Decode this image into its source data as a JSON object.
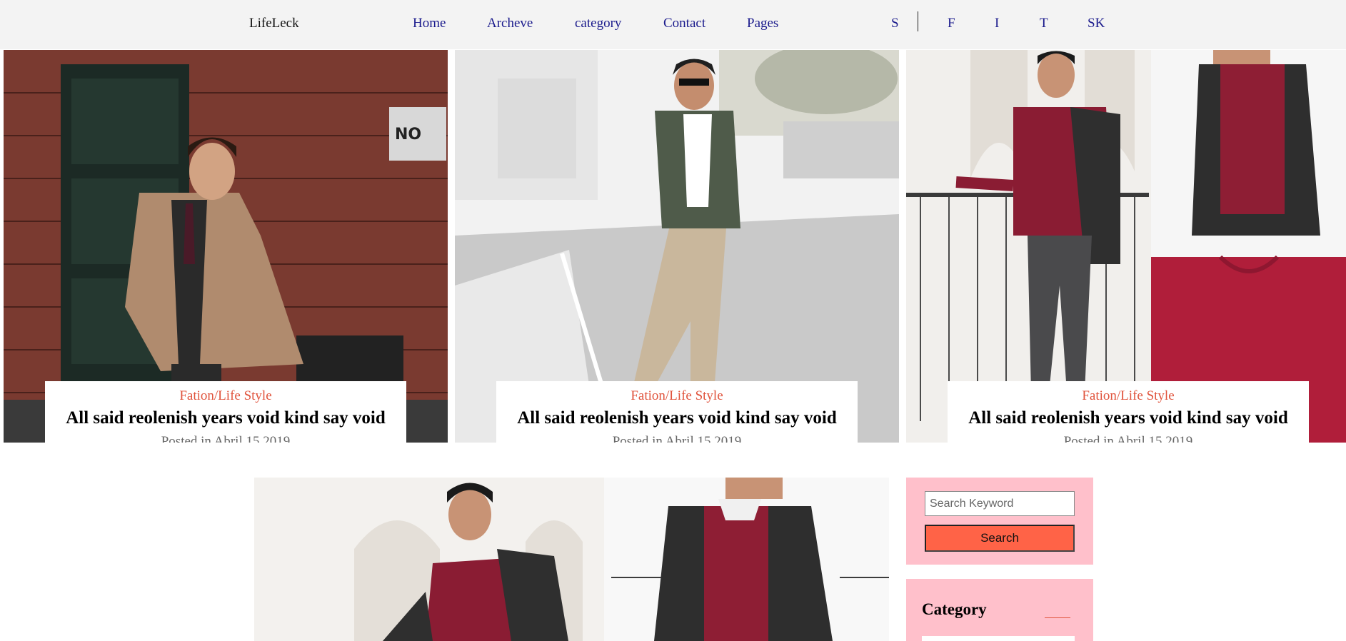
{
  "nav": {
    "brand": "LifeLeck",
    "links": [
      "Home",
      "Archeve",
      "category",
      "Contact",
      "Pages"
    ],
    "social": [
      "S",
      "F",
      "I",
      "T",
      "SK"
    ]
  },
  "featured": [
    {
      "category": "Fation/Life Style",
      "title": "All said reolenish years void kind say void",
      "date": "Posted in Abril 15,2019"
    },
    {
      "category": "Fation/Life Style",
      "title": "All said reolenish years void kind say void",
      "date": "Posted in Abril 15,2019"
    },
    {
      "category": "Fation/Life Style",
      "title": "All said reolenish years void kind say void",
      "date": "Posted in Abril 15,2019"
    }
  ],
  "sidebar": {
    "search_placeholder": "Search Keyword",
    "search_button": "Search",
    "category_title": "Category"
  },
  "colors": {
    "nav_bg": "#f3f3f3",
    "nav_link": "#1a1a8c",
    "accent": "#e0533c",
    "widget_bg": "#ffc0cb",
    "search_button": "#ff6347"
  }
}
